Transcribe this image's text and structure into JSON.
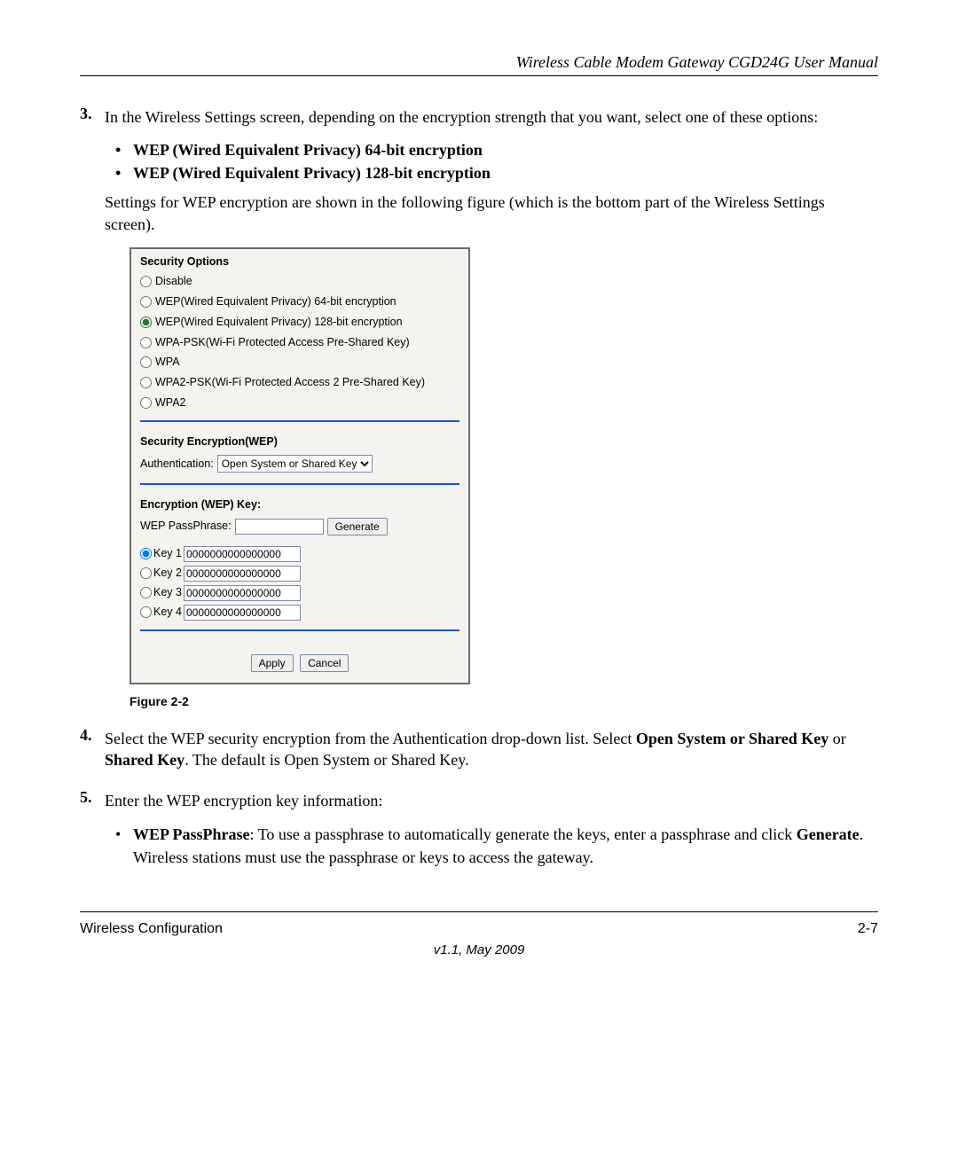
{
  "header": {
    "title": "Wireless Cable Modem Gateway CGD24G User Manual"
  },
  "step3": {
    "num": "3.",
    "lead": "In the Wireless Settings screen, depending on the encryption strength that you want, select one of these options:",
    "opt64": "WEP (Wired Equivalent Privacy) 64-bit encryption",
    "opt128": "WEP (Wired Equivalent Privacy) 128-bit encryption",
    "tail": "Settings for WEP encryption are shown in the following figure (which is the bottom part of the Wireless Settings screen)."
  },
  "dialog": {
    "security_options_title": "Security Options",
    "radios": {
      "disable": "Disable",
      "wep64": "WEP(Wired Equivalent Privacy) 64-bit encryption",
      "wep128": "WEP(Wired Equivalent Privacy) 128-bit encryption",
      "wpapsk": "WPA-PSK(Wi-Fi Protected Access Pre-Shared Key)",
      "wpa": "WPA",
      "wpa2psk": "WPA2-PSK(Wi-Fi Protected Access 2 Pre-Shared Key)",
      "wpa2": "WPA2"
    },
    "sec_enc_title": "Security Encryption(WEP)",
    "auth_label": "Authentication:",
    "auth_selected": "Open System or Shared Key",
    "enc_key_title": "Encryption (WEP) Key:",
    "passphrase_label": "WEP PassPhrase:",
    "generate": "Generate",
    "keys": [
      {
        "label": "Key 1",
        "value": "0000000000000000"
      },
      {
        "label": "Key 2",
        "value": "0000000000000000"
      },
      {
        "label": "Key 3",
        "value": "0000000000000000"
      },
      {
        "label": "Key 4",
        "value": "0000000000000000"
      }
    ],
    "apply": "Apply",
    "cancel": "Cancel"
  },
  "figure_caption": "Figure 2-2",
  "step4": {
    "num": "4.",
    "text_pre": "Select the WEP security encryption from the Authentication drop-down list. Select ",
    "bold1": "Open System or Shared Key",
    "mid": " or ",
    "bold2": "Shared Key",
    "text_post": ". The default is Open System or Shared Key."
  },
  "step5": {
    "num": "5.",
    "lead": "Enter the WEP encryption key information:",
    "bullet_bold": "WEP PassPhrase",
    "bullet_pre": ": To use a passphrase to automatically generate the keys, enter a passphrase and click ",
    "bullet_gen": "Generate",
    "bullet_post": ". Wireless stations must use the passphrase or keys to access the gateway."
  },
  "footer": {
    "left": "Wireless Configuration",
    "right": "2-7",
    "version": "v1.1, May 2009"
  }
}
